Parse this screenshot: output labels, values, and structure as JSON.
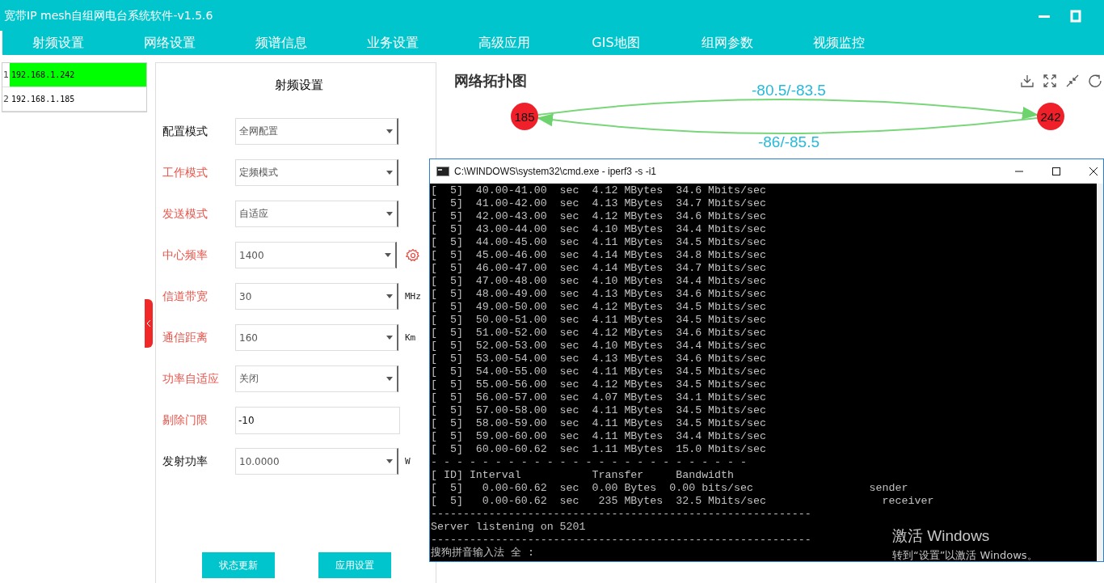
{
  "window": {
    "title": "宽带IP mesh自组网电台系统软件-v1.5.6"
  },
  "menu": [
    "射频设置",
    "网络设置",
    "频谱信息",
    "业务设置",
    "高级应用",
    "GIS地图",
    "组网参数",
    "视频监控"
  ],
  "devices": [
    {
      "index": "1",
      "ip": "192.168.1.242",
      "selected": true
    },
    {
      "index": "2",
      "ip": "192.168.1.185",
      "selected": false
    }
  ],
  "rf_panel": {
    "title": "射频设置",
    "fields": [
      {
        "label": "配置模式",
        "highlight": false,
        "kind": "select",
        "value": "全网配置"
      },
      {
        "label": "工作模式",
        "highlight": true,
        "kind": "select",
        "value": "定频模式"
      },
      {
        "label": "发送模式",
        "highlight": true,
        "kind": "select",
        "value": "自适应"
      },
      {
        "label": "中心频率",
        "highlight": true,
        "kind": "select",
        "value": "1400",
        "settings": true
      },
      {
        "label": "信道带宽",
        "highlight": true,
        "kind": "select",
        "value": "30",
        "unit": "MHz"
      },
      {
        "label": "通信距离",
        "highlight": true,
        "kind": "select",
        "value": "160",
        "unit": "Km"
      },
      {
        "label": "功率自适应",
        "highlight": true,
        "kind": "select",
        "value": "关闭"
      },
      {
        "label": "剔除门限",
        "highlight": true,
        "kind": "input",
        "value": "-10"
      },
      {
        "label": "发射功率",
        "highlight": false,
        "kind": "select",
        "value": "10.0000",
        "unit": "W"
      }
    ],
    "buttons": [
      "状态更新",
      "应用设置"
    ]
  },
  "topology": {
    "title": "网络拓扑图",
    "nodes": [
      "185",
      "242"
    ],
    "links": [
      "-80.5/-83.5",
      "-86/-85.5"
    ]
  },
  "console": {
    "title": "C:\\WINDOWS\\system32\\cmd.exe - iperf3  -s -i1",
    "lines": [
      "[  5]  40.00-41.00  sec  4.12 MBytes  34.6 Mbits/sec",
      "[  5]  41.00-42.00  sec  4.13 MBytes  34.7 Mbits/sec",
      "[  5]  42.00-43.00  sec  4.12 MBytes  34.6 Mbits/sec",
      "[  5]  43.00-44.00  sec  4.10 MBytes  34.4 Mbits/sec",
      "[  5]  44.00-45.00  sec  4.11 MBytes  34.5 Mbits/sec",
      "[  5]  45.00-46.00  sec  4.14 MBytes  34.8 Mbits/sec",
      "[  5]  46.00-47.00  sec  4.14 MBytes  34.7 Mbits/sec",
      "[  5]  47.00-48.00  sec  4.10 MBytes  34.4 Mbits/sec",
      "[  5]  48.00-49.00  sec  4.13 MBytes  34.6 Mbits/sec",
      "[  5]  49.00-50.00  sec  4.12 MBytes  34.5 Mbits/sec",
      "[  5]  50.00-51.00  sec  4.11 MBytes  34.5 Mbits/sec",
      "[  5]  51.00-52.00  sec  4.12 MBytes  34.6 Mbits/sec",
      "[  5]  52.00-53.00  sec  4.10 MBytes  34.4 Mbits/sec",
      "[  5]  53.00-54.00  sec  4.13 MBytes  34.6 Mbits/sec",
      "[  5]  54.00-55.00  sec  4.11 MBytes  34.5 Mbits/sec",
      "[  5]  55.00-56.00  sec  4.12 MBytes  34.5 Mbits/sec",
      "[  5]  56.00-57.00  sec  4.07 MBytes  34.1 Mbits/sec",
      "[  5]  57.00-58.00  sec  4.11 MBytes  34.5 Mbits/sec",
      "[  5]  58.00-59.00  sec  4.11 MBytes  34.5 Mbits/sec",
      "[  5]  59.00-60.00  sec  4.11 MBytes  34.4 Mbits/sec",
      "[  5]  60.00-60.62  sec  1.11 MBytes  15.0 Mbits/sec",
      "- - - - - - - - - - - - - - - - - - - - - - - - -",
      "[ ID] Interval           Transfer     Bandwidth",
      "[  5]   0.00-60.62  sec  0.00 Bytes  0.00 bits/sec                  sender",
      "[  5]   0.00-60.62  sec   235 MBytes  32.5 Mbits/sec                  receiver",
      "-----------------------------------------------------------",
      "Server listening on 5201",
      "-----------------------------------------------------------",
      "搜狗拼音输入法 全 :"
    ],
    "activation": [
      "激活 Windows",
      "转到“设置”以激活 Windows。"
    ]
  }
}
